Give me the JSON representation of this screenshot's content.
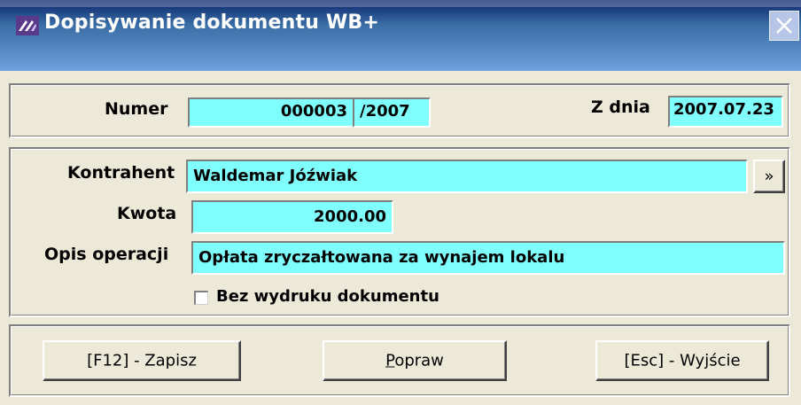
{
  "window": {
    "title": "Dopisywanie dokumentu WB+"
  },
  "header": {
    "numer_label": "Numer",
    "numer_value": "000003",
    "numer_year": "/2007",
    "date_label": "Z dnia",
    "date_value": "2007.07.23"
  },
  "form": {
    "kontrahent_label": "Kontrahent",
    "kontrahent_value": "Waldemar Jóźwiak",
    "browse_button": "»",
    "kwota_label": "Kwota",
    "kwota_value": "2000.00",
    "opis_label": "Opis operacji",
    "opis_value": "Opłata zryczałtowana za wynajem lokalu",
    "checkbox_label": "Bez wydruku dokumentu",
    "checkbox_checked": false
  },
  "buttons": {
    "save": "[F12] - Zapisz",
    "fix_prefix": "",
    "fix_underline": "P",
    "fix_rest": "opraw",
    "exit": "[Esc] - Wyjście"
  },
  "colors": {
    "field_bg": "#80ffff",
    "title_start": "#0a246a",
    "title_end": "#6fa1de"
  }
}
